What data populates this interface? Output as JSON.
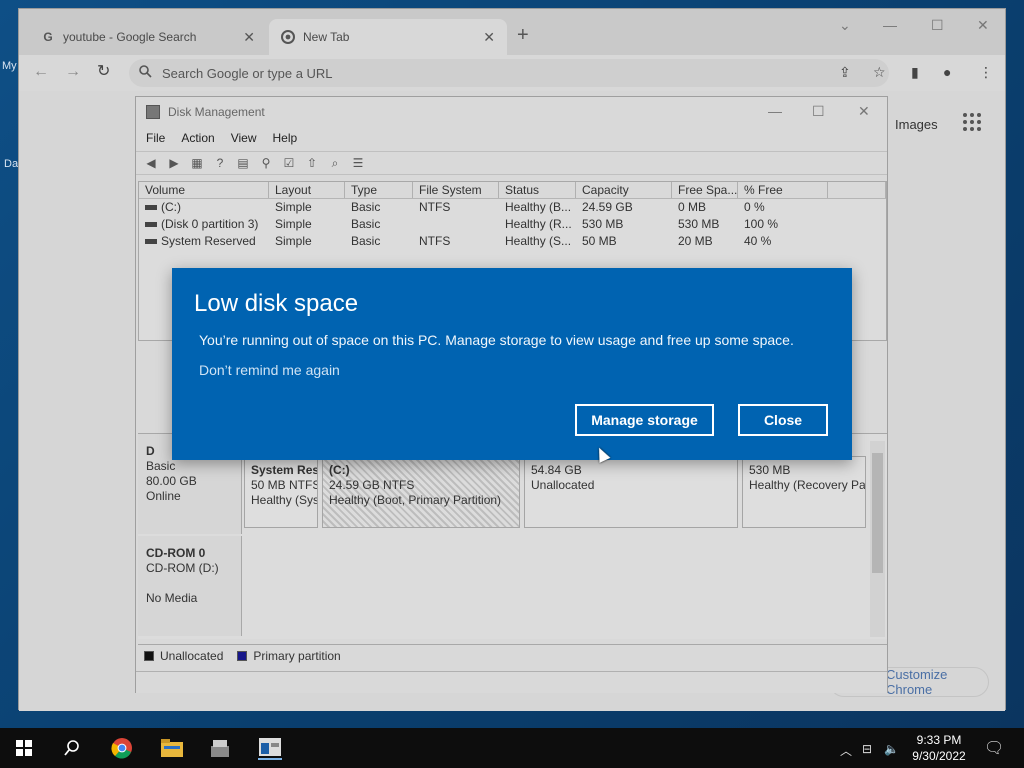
{
  "browser": {
    "tabs": [
      {
        "title": "youtube - Google Search",
        "favicon": "G"
      },
      {
        "title": "New Tab",
        "favicon": "chrome-icon"
      }
    ],
    "omnibox_placeholder": "Search Google or type a URL",
    "page": {
      "images_link": "Images",
      "customize_label": "Customize Chrome"
    }
  },
  "desktop": {
    "icon_label_1": "My",
    "icon_label_2": "Da"
  },
  "disk_management": {
    "title": "Disk Management",
    "menu": [
      "File",
      "Action",
      "View",
      "Help"
    ],
    "columns": [
      "Volume",
      "Layout",
      "Type",
      "File System",
      "Status",
      "Capacity",
      "Free Spa...",
      "% Free"
    ],
    "volumes": [
      {
        "volume": "(C:)",
        "layout": "Simple",
        "type": "Basic",
        "fs": "NTFS",
        "status": "Healthy (B...",
        "capacity": "24.59 GB",
        "free": "0 MB",
        "pct": "0 %"
      },
      {
        "volume": "(Disk 0 partition 3)",
        "layout": "Simple",
        "type": "Basic",
        "fs": "",
        "status": "Healthy (R...",
        "capacity": "530 MB",
        "free": "530 MB",
        "pct": "100 %"
      },
      {
        "volume": "System Reserved",
        "layout": "Simple",
        "type": "Basic",
        "fs": "NTFS",
        "status": "Healthy (S...",
        "capacity": "50 MB",
        "free": "20 MB",
        "pct": "40 %"
      }
    ],
    "disk0": {
      "name": "D",
      "type": "Basic",
      "size": "80.00 GB",
      "state": "Online",
      "partitions": [
        {
          "name": "System Res",
          "size": "50 MB NTFS",
          "status": "Healthy (Sys"
        },
        {
          "name": "(C:)",
          "size": "24.59 GB NTFS",
          "status": "Healthy (Boot, Primary Partition)"
        },
        {
          "name": "",
          "size": "54.84 GB",
          "status": "Unallocated"
        },
        {
          "name": "",
          "size": "530 MB",
          "status": "Healthy (Recovery Pa"
        }
      ]
    },
    "cdrom": {
      "name": "CD-ROM 0",
      "type": "CD-ROM (D:)",
      "media": "No Media"
    },
    "legend": {
      "unallocated": "Unallocated",
      "primary": "Primary partition"
    }
  },
  "toast": {
    "title": "Low disk space",
    "message": "You’re running out of space on this PC. Manage storage to view usage and free up some space.",
    "dont_remind": "Don’t remind me again",
    "manage_button": "Manage storage",
    "close_button": "Close"
  },
  "taskbar": {
    "time": "9:33 PM",
    "date": "9/30/2022"
  },
  "colors": {
    "toast_bg": "#0063b1",
    "primary_partition": "#17178a"
  }
}
